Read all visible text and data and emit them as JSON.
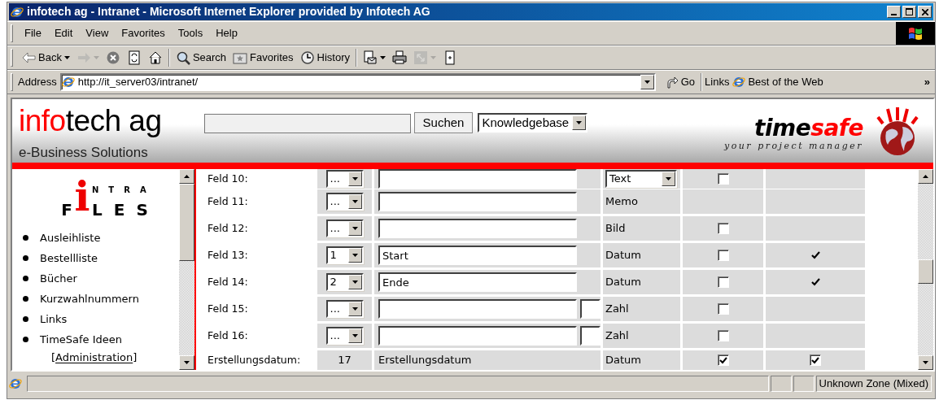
{
  "window": {
    "title": "infotech ag - Intranet - Microsoft Internet Explorer provided by Infotech AG"
  },
  "menu": [
    {
      "label": "File"
    },
    {
      "label": "Edit"
    },
    {
      "label": "View"
    },
    {
      "label": "Favorites"
    },
    {
      "label": "Tools"
    },
    {
      "label": "Help"
    }
  ],
  "toolbar": [
    {
      "kind": "back",
      "label": "Back",
      "dropdown": true,
      "disabled": false
    },
    {
      "kind": "forward",
      "dropdown": true,
      "disabled": true
    },
    {
      "kind": "stop",
      "dropdown": false,
      "disabled": false
    },
    {
      "kind": "refresh",
      "dropdown": false,
      "disabled": false
    },
    {
      "kind": "home",
      "dropdown": false,
      "disabled": false
    },
    {
      "kind": "separator"
    },
    {
      "kind": "search",
      "label": "Search",
      "dropdown": false,
      "disabled": false
    },
    {
      "kind": "favorites",
      "label": "Favorites",
      "dropdown": false,
      "disabled": false
    },
    {
      "kind": "history",
      "label": "History",
      "dropdown": false,
      "disabled": false
    },
    {
      "kind": "separator"
    },
    {
      "kind": "mail",
      "dropdown": true,
      "disabled": false
    },
    {
      "kind": "print",
      "dropdown": false,
      "disabled": false
    },
    {
      "kind": "edit",
      "dropdown": true,
      "disabled": true
    },
    {
      "kind": "discuss",
      "dropdown": false,
      "disabled": false
    }
  ],
  "address": {
    "label": "Address",
    "url": "http://it_server03/intranet/",
    "go": "Go",
    "links_label": "Links",
    "link": "Best of the Web",
    "more": "»"
  },
  "header": {
    "search_button": "Suchen",
    "scope": "Knowledgebase",
    "brand": {
      "accent": "info",
      "rest": "tech ag",
      "tagline": "e-Business Solutions"
    },
    "partner": {
      "main": "time",
      "accent": "safe",
      "tagline": "your project manager"
    }
  },
  "sidebar": {
    "logo": {
      "big": "i",
      "upper": "NTRA",
      "lower_left": "F",
      "lower_right": "LES"
    },
    "items": [
      "Ausleihliste",
      "Bestellliste",
      "Bücher",
      "Kurzwahlnummern",
      "Links",
      "TimeSafe Ideen"
    ],
    "sub_link": {
      "open": "[",
      "label": "Administration",
      "close": "]"
    }
  },
  "rows": [
    {
      "label": "Feld 10:",
      "order": {
        "kind": "select",
        "value": "..."
      },
      "name": {
        "kind": "input"
      },
      "size_field": false,
      "type": {
        "kind": "select",
        "value": "Text"
      },
      "checkbox": {
        "checked": false
      }
    },
    {
      "label": "Feld 11:",
      "order": {
        "kind": "select",
        "value": "..."
      },
      "name": {
        "kind": "input"
      },
      "size_field": false,
      "type": {
        "kind": "text",
        "value": "Memo"
      }
    },
    {
      "label": "Feld 12:",
      "order": {
        "kind": "select",
        "value": "..."
      },
      "name": {
        "kind": "input"
      },
      "size_field": false,
      "type": {
        "kind": "text",
        "value": "Bild"
      },
      "checkbox": {
        "checked": false
      }
    },
    {
      "label": "Feld 13:",
      "order": {
        "kind": "select",
        "value": "1"
      },
      "name": {
        "kind": "input",
        "value": "Start"
      },
      "size_field": false,
      "type": {
        "kind": "text",
        "value": "Datum"
      },
      "checkbox": {
        "checked": false
      },
      "column_5": {
        "kind": "tick"
      }
    },
    {
      "label": "Feld 14:",
      "order": {
        "kind": "select",
        "value": "2"
      },
      "name": {
        "kind": "input",
        "value": "Ende"
      },
      "size_field": false,
      "type": {
        "kind": "text",
        "value": "Datum"
      },
      "checkbox": {
        "checked": false
      },
      "column_5": {
        "kind": "tick"
      }
    },
    {
      "label": "Feld 15:",
      "order": {
        "kind": "select",
        "value": "..."
      },
      "name": {
        "kind": "input"
      },
      "size_field": true,
      "type": {
        "kind": "text",
        "value": "Zahl"
      },
      "checkbox": {
        "checked": false
      }
    },
    {
      "label": "Feld 16:",
      "order": {
        "kind": "select",
        "value": "..."
      },
      "name": {
        "kind": "input"
      },
      "size_field": true,
      "type": {
        "kind": "text",
        "value": "Zahl"
      },
      "checkbox": {
        "checked": false
      }
    },
    {
      "label": "Erstellungsdatum:",
      "order": {
        "kind": "text",
        "value": "17"
      },
      "name": {
        "kind": "text",
        "value": "Erstellungsdatum"
      },
      "size_field": false,
      "type": {
        "kind": "text",
        "value": "Datum"
      },
      "checkbox": {
        "checked": true
      },
      "column_5": {
        "kind": "checkbox",
        "checked": true
      }
    }
  ],
  "status_bar": {
    "zone": "Unknown Zone (Mixed)"
  }
}
